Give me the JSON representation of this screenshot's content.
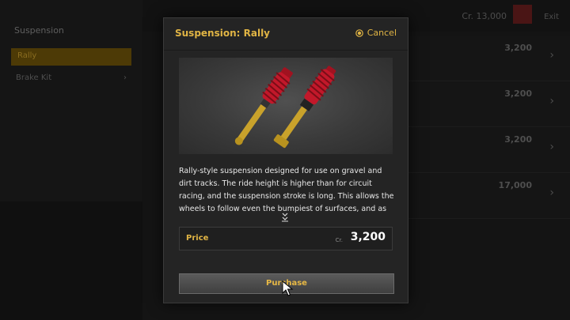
{
  "background": {
    "sidebar_category": "Suspension",
    "sidebar_selected": "Rally",
    "sidebar_item2": "Brake Kit",
    "credits": "Cr. 13,000",
    "close_label": "Exit",
    "row_prices": [
      "3,200",
      "3,200",
      "3,200",
      "17,000"
    ]
  },
  "modal": {
    "title": "Suspension: Rally",
    "cancel_label": "Cancel",
    "description": "Rally-style suspension designed for use on gravel and dirt tracks. The ride height is higher than for circuit racing, and the suspension stroke is long. This allows the wheels to follow even the bumpiest of surfaces, and as much",
    "price_label": "Price",
    "price_currency": "Cr.",
    "price_value": "3,200",
    "purchase_label": "Purchase"
  },
  "colors": {
    "accent": "#e0b444",
    "modal_bg": "#242424",
    "shock_red": "#c2182a",
    "shock_gold": "#c9a22b"
  },
  "icons": {
    "cancel": "circle-button-icon",
    "scroll": "scroll-down-icon",
    "pointer": "mouse-pointer-icon"
  }
}
